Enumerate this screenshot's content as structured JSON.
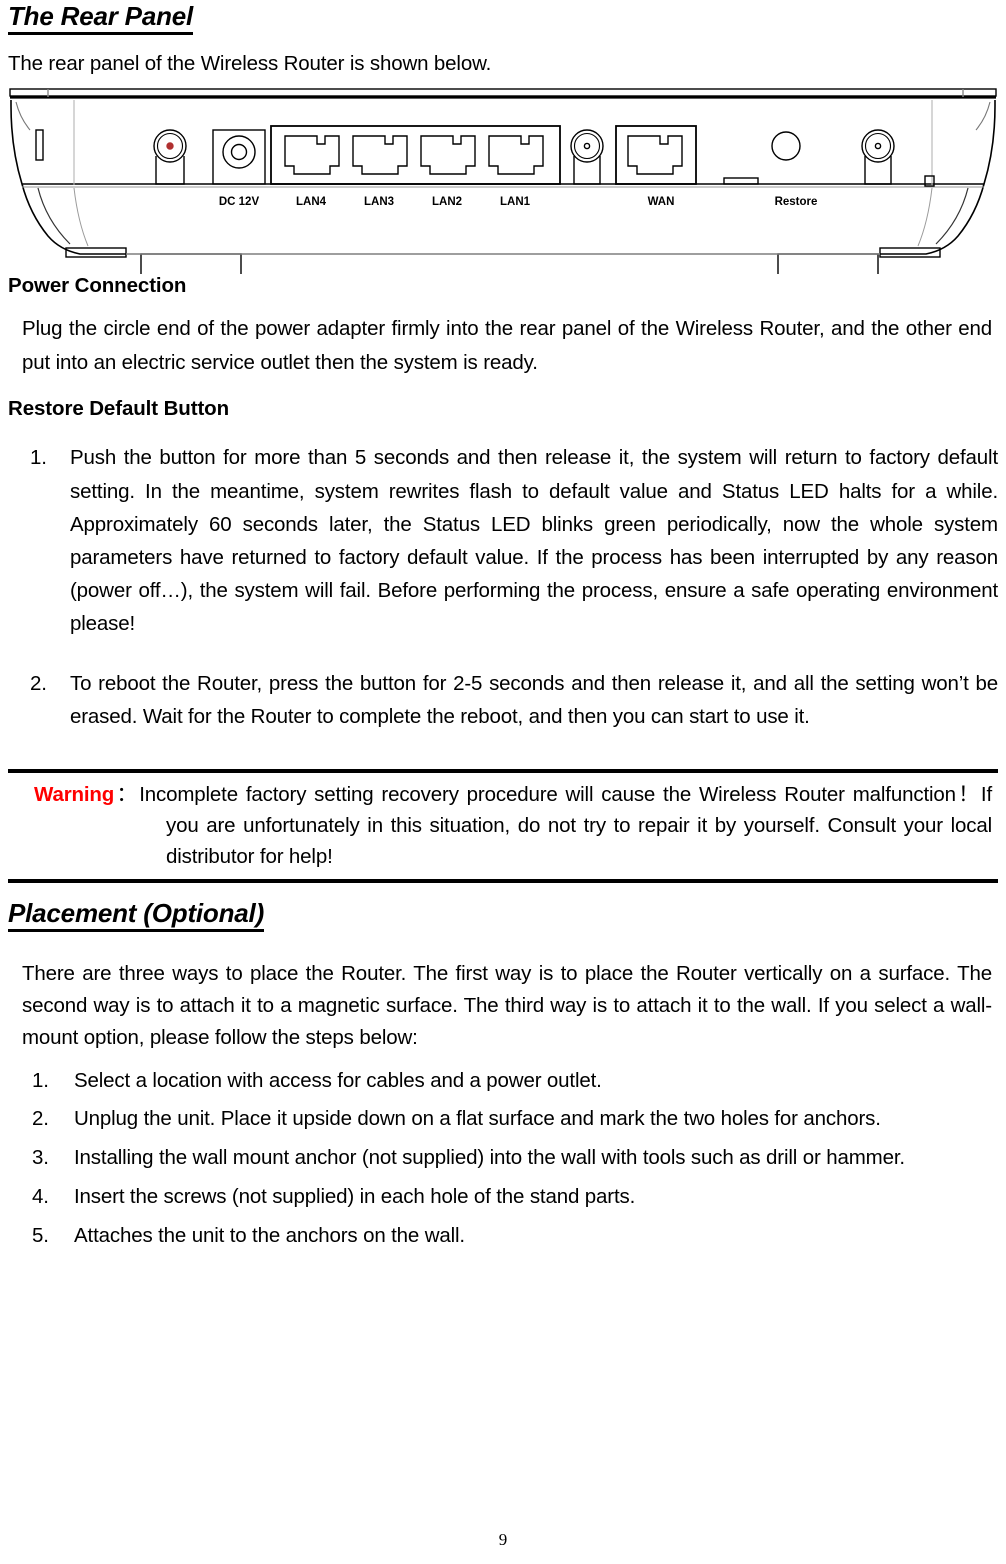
{
  "document": {
    "page_number": "9"
  },
  "section_rear_panel": {
    "heading": "The Rear Panel",
    "intro": "The rear panel of the Wireless Router is shown below."
  },
  "figure": {
    "name": "wireless-router-rear-panel-diagram",
    "port_labels": [
      "DC 12V",
      "LAN4",
      "LAN3",
      "LAN2",
      "LAN1",
      "WAN",
      "Restore"
    ]
  },
  "power_connection": {
    "heading": "Power Connection",
    "body": "Plug the circle end of the power adapter firmly into the rear panel of the Wireless Router, and the other end put into an electric service outlet then the system is ready."
  },
  "restore_default": {
    "heading": "Restore Default Button",
    "items": [
      {
        "num": "1.",
        "text": "Push the button for more than 5 seconds and then release it, the system will return to factory default setting. In the meantime, system rewrites flash to default value and Status LED halts for a while. Approximately 60 seconds later, the Status LED blinks green periodically, now the whole system parameters have returned to factory default value. If the process has been interrupted by any reason (power off…), the system will fail. Before performing the process, ensure a safe operating environment please!"
      },
      {
        "num": "2.",
        "text": "To reboot the Router, press the button for 2-5 seconds and then release it, and all the setting won’t be erased. Wait for the Router to complete the reboot, and then you can start to use it."
      }
    ]
  },
  "warning": {
    "label": "Warning",
    "separator": "：",
    "text": "Incomplete factory setting recovery procedure will cause the Wireless Router malfunction！If you are unfortunately in this situation, do not try to repair it by yourself. Consult your local distributor for help!",
    "label_color": "#ff0000"
  },
  "placement": {
    "heading": "Placement (Optional)",
    "intro": "There are three ways to place the Router. The first way is to place the Router vertically on a surface. The second way is to attach it to a magnetic surface. The third way is to attach it to the wall. If you select a wall-mount option, please follow the steps below:",
    "items": [
      {
        "num": "1.",
        "text": "Select a location with access for cables and a power outlet."
      },
      {
        "num": "2.",
        "text": "Unplug the unit. Place it upside down on a flat surface and mark the two holes for anchors."
      },
      {
        "num": "3.",
        "text": "Installing the wall mount anchor (not supplied) into the wall with tools such as drill or hammer."
      },
      {
        "num": "4.",
        "text": "Insert the screws (not supplied) in each hole of the stand parts."
      },
      {
        "num": "5.",
        "text": "Attaches the unit to the anchors on the wall."
      }
    ]
  }
}
